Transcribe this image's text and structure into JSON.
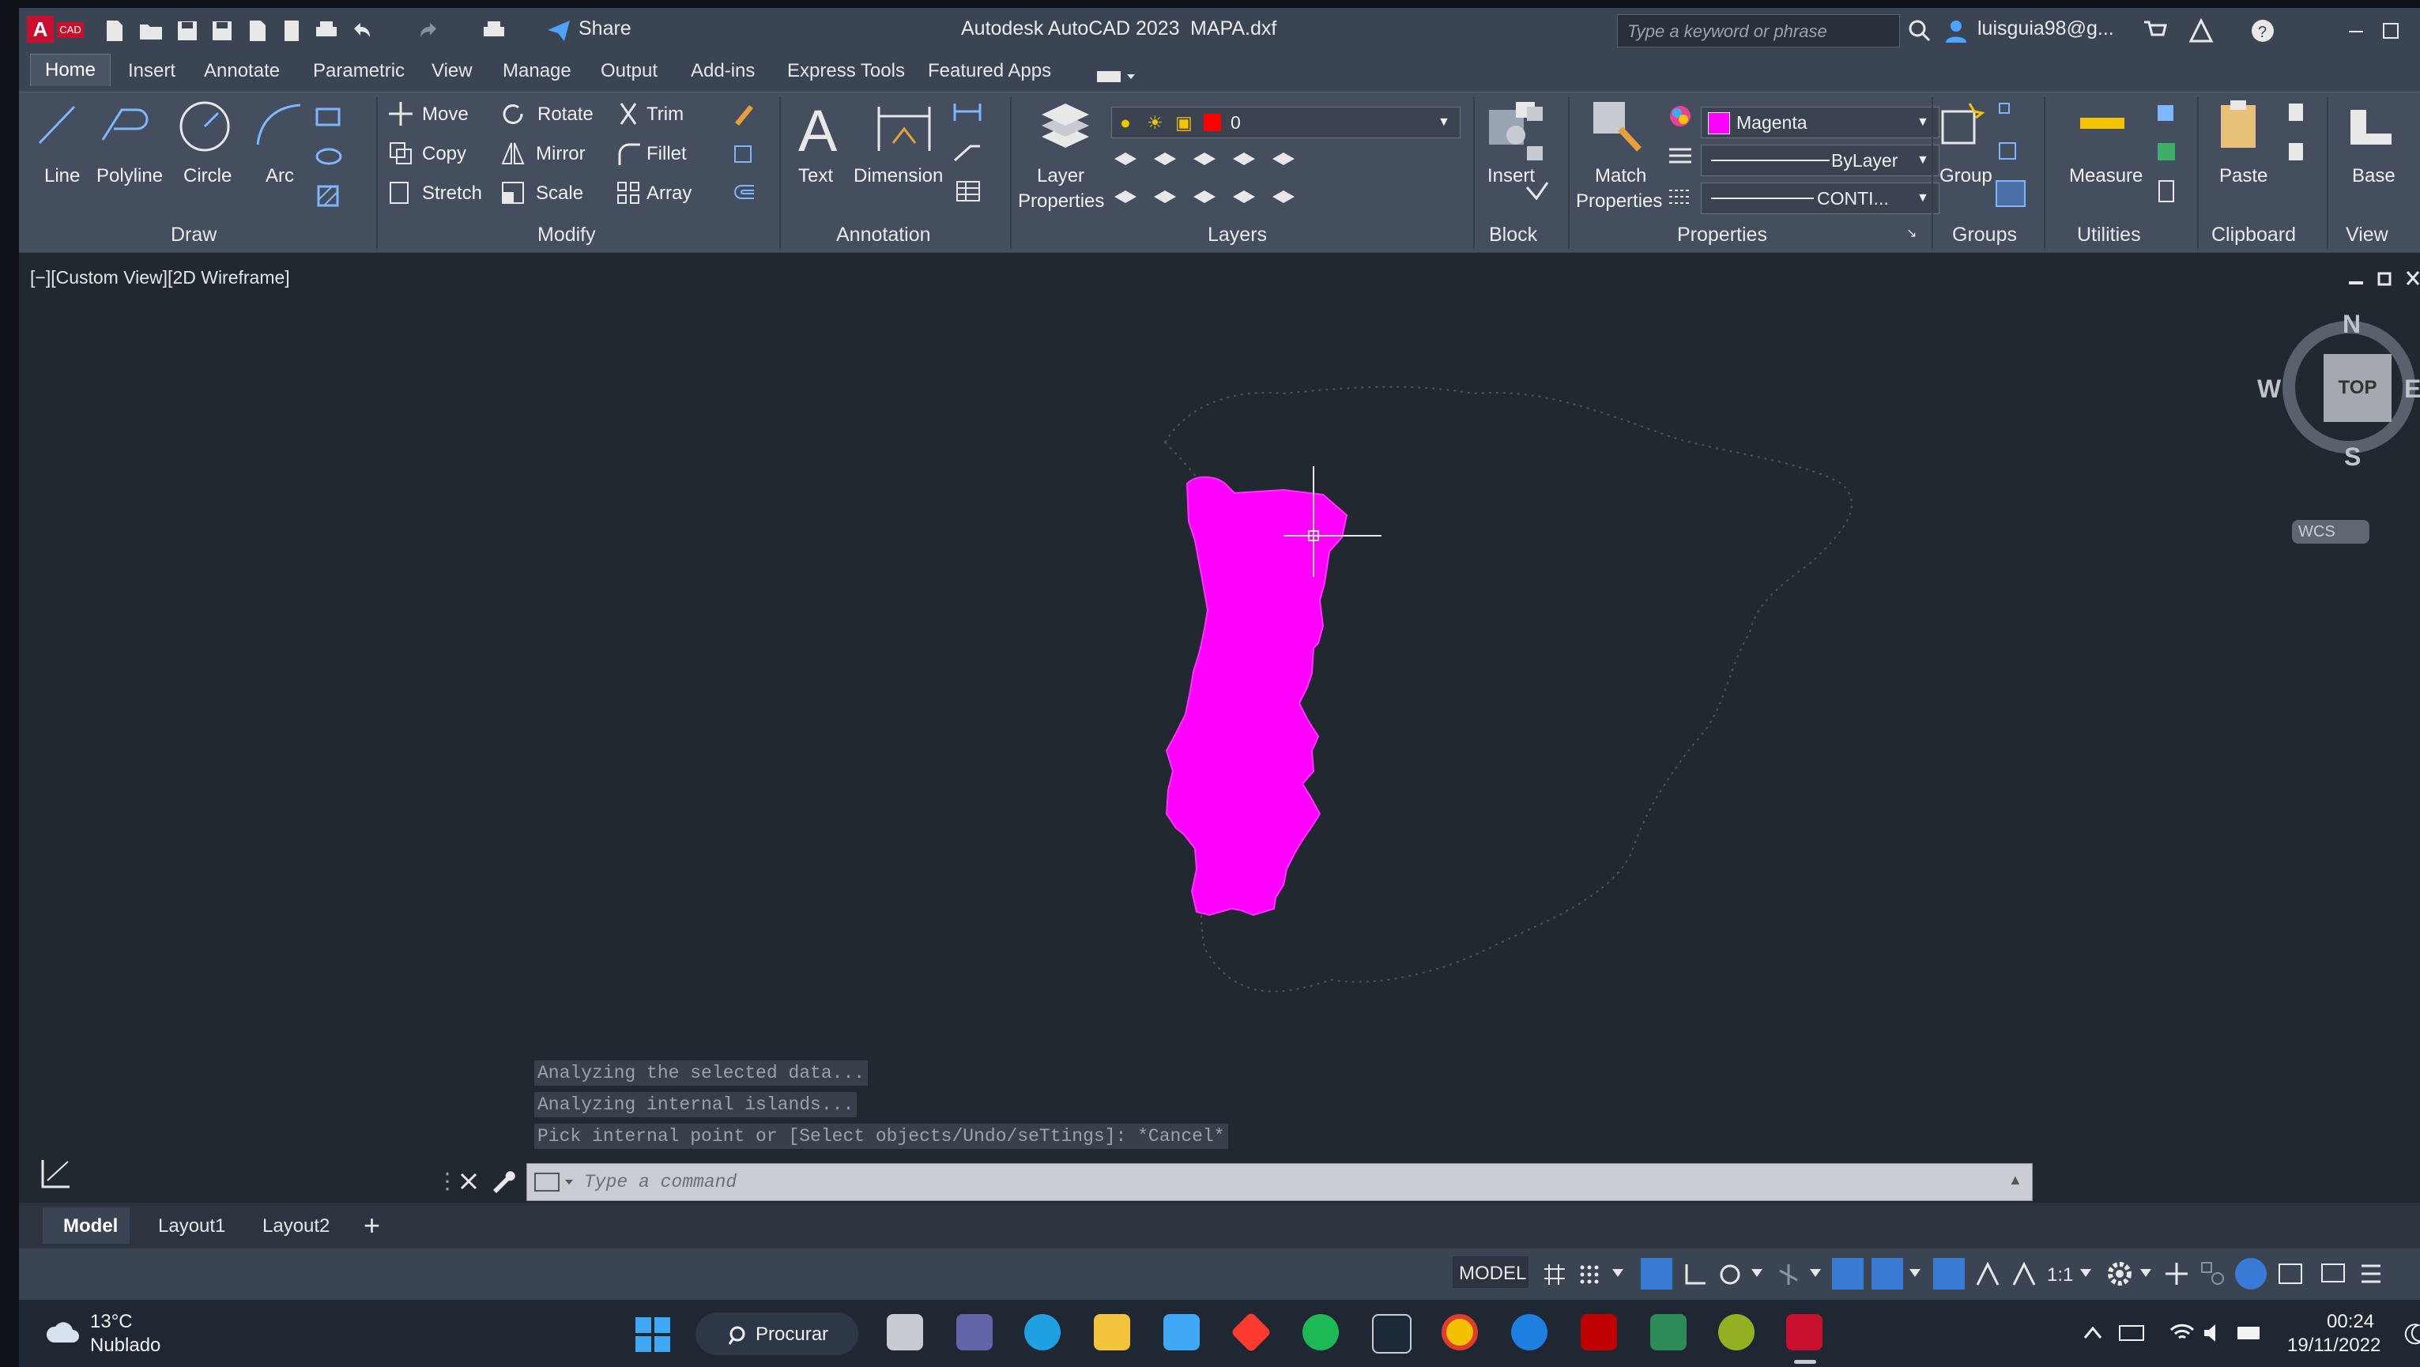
{
  "title_bar": {
    "app_title": "Autodesk AutoCAD 2023",
    "file_name": "MAPA.dxf",
    "share_label": "Share",
    "search_placeholder": "Type a keyword or phrase",
    "user_name": "luisguia98@g..."
  },
  "tabs": [
    "Home",
    "Insert",
    "Annotate",
    "Parametric",
    "View",
    "Manage",
    "Output",
    "Add-ins",
    "Express Tools",
    "Featured Apps"
  ],
  "ribbon": {
    "draw": {
      "title": "Draw",
      "line": "Line",
      "polyline": "Polyline",
      "circle": "Circle",
      "arc": "Arc"
    },
    "modify": {
      "title": "Modify",
      "move": "Move",
      "rotate": "Rotate",
      "trim": "Trim",
      "copy": "Copy",
      "mirror": "Mirror",
      "fillet": "Fillet",
      "stretch": "Stretch",
      "scale": "Scale",
      "array": "Array"
    },
    "annotation": {
      "title": "Annotation",
      "text": "Text",
      "dimension": "Dimension"
    },
    "layers": {
      "title": "Layers",
      "layer_properties_1": "Layer",
      "layer_properties_2": "Properties",
      "current_layer": "0"
    },
    "block": {
      "title": "Block",
      "insert": "Insert"
    },
    "properties": {
      "title": "Properties",
      "match_1": "Match",
      "match_2": "Properties",
      "color": "Magenta",
      "lineweight": "ByLayer",
      "linetype": "CONTI..."
    },
    "groups": {
      "title": "Groups",
      "group": "Group"
    },
    "utilities": {
      "title": "Utilities",
      "measure": "Measure"
    },
    "clipboard": {
      "title": "Clipboard",
      "paste": "Paste"
    },
    "view": {
      "title": "View",
      "base": "Base"
    }
  },
  "viewport": {
    "label": "[−][Custom View][2D Wireframe]",
    "compass": {
      "n": "N",
      "s": "S",
      "e": "E",
      "w": "W",
      "top": "TOP",
      "wcs": "WCS"
    }
  },
  "command": {
    "history": [
      "Analyzing the selected data...",
      "Analyzing internal islands...",
      "Pick internal point or [Select objects/Undo/seTtings]: *Cancel*"
    ],
    "placeholder": "Type a command"
  },
  "layout_tabs": [
    "Model",
    "Layout1",
    "Layout2"
  ],
  "status_bar": {
    "model": "MODEL",
    "scale": "1:1"
  },
  "taskbar": {
    "temperature": "13°C",
    "weather": "Nublado",
    "search": "Procurar",
    "time": "00:24",
    "date": "19/11/2022"
  },
  "colors": {
    "accent_magenta": "#ff00ff",
    "viewport_bg": "#212830",
    "ribbon_bg": "#454e5e"
  }
}
